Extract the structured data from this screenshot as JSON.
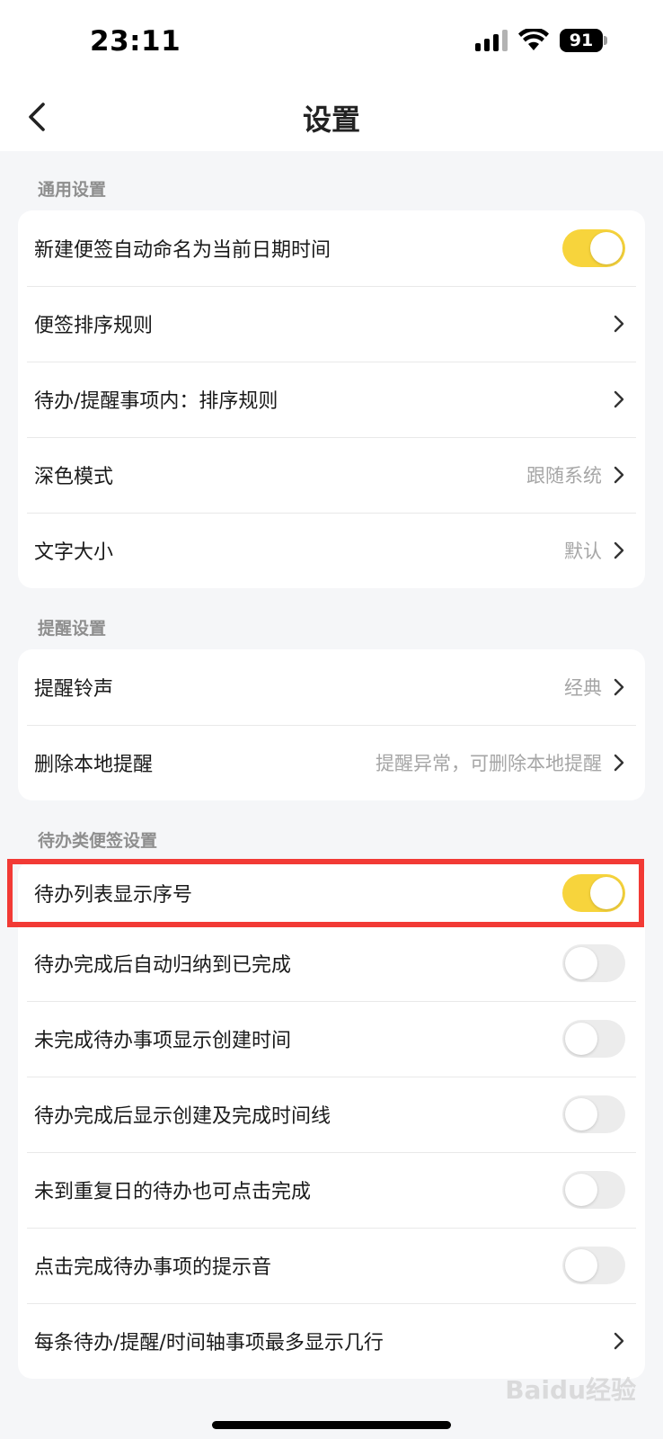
{
  "status_bar": {
    "time": "23:11",
    "battery": "91",
    "icons": [
      "cellular-signal-icon",
      "wifi-icon",
      "battery-icon"
    ]
  },
  "header": {
    "title": "设置",
    "back_icon": "chevron-left-icon"
  },
  "sections": {
    "general": {
      "label": "通用设置",
      "rows": [
        {
          "label": "新建便签自动命名为当前日期时间",
          "toggle": true
        },
        {
          "label": "便签排序规则"
        },
        {
          "label": "待办/提醒事项内：排序规则"
        },
        {
          "label": "深色模式",
          "value": "跟随系统"
        },
        {
          "label": "文字大小",
          "value": "默认"
        }
      ]
    },
    "reminder": {
      "label": "提醒设置",
      "rows": [
        {
          "label": "提醒铃声",
          "value": "经典"
        },
        {
          "label": "删除本地提醒",
          "value": "提醒异常，可删除本地提醒"
        }
      ]
    },
    "todo": {
      "label": "待办类便签设置",
      "rows": [
        {
          "label": "待办列表显示序号",
          "toggle": true
        },
        {
          "label": "待办完成后自动归纳到已完成",
          "toggle": false
        },
        {
          "label": "未完成待办事项显示创建时间",
          "toggle": false
        },
        {
          "label": "待办完成后显示创建及完成时间线",
          "toggle": false
        },
        {
          "label": "未到重复日的待办也可点击完成",
          "toggle": false
        },
        {
          "label": "点击完成待办事项的提示音",
          "toggle": false
        },
        {
          "label": "每条待办/提醒/时间轴事项最多显示几行"
        }
      ]
    }
  },
  "watermark": "Baidu经验",
  "colors": {
    "accent_toggle_on": "#f7d43c",
    "toggle_off": "#ececec",
    "highlight": "#f23a35",
    "background": "#f5f6f8",
    "secondary_text": "#a6a6a6"
  }
}
